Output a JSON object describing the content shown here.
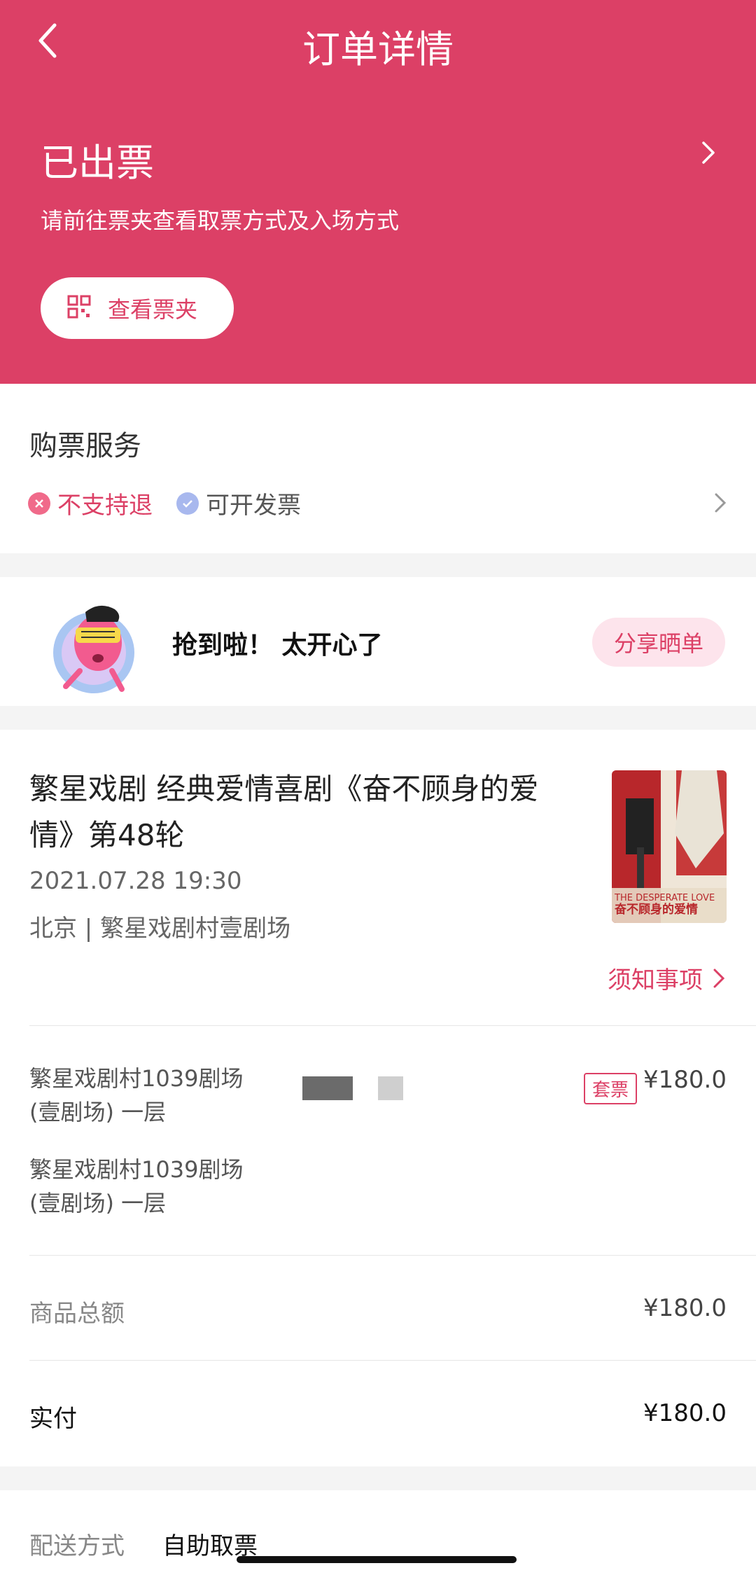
{
  "header": {
    "title": "订单详情",
    "status": "已出票",
    "hint": "请前往票夹查看取票方式及入场方式",
    "wallet_button": "查看票夹"
  },
  "service": {
    "title": "购票服务",
    "no_refund": "不支持退",
    "invoice": "可开发票"
  },
  "share": {
    "text": "抢到啦！ 太开心了",
    "button": "分享晒单"
  },
  "show": {
    "title": "繁星戏剧 经典爱情喜剧《奋不顾身的爱情》第48轮",
    "datetime": "2021.07.28 19:30",
    "venue": "北京 | 繁星戏剧村壹剧场",
    "notice": "须知事项",
    "poster_text_en": "THE DESPERATE LOVE",
    "poster_text_cn": "奋不顾身的爱情"
  },
  "tickets": {
    "seat1_line1": "繁星戏剧村1039剧场",
    "seat1_line2": "(壹剧场) 一层",
    "seat2_line1": "繁星戏剧村1039剧场",
    "seat2_line2": "(壹剧场) 一层",
    "tag": "套票",
    "price": "¥180.0"
  },
  "summary": {
    "goods_total_label": "商品总额",
    "goods_total_value": "¥180.0",
    "paid_label": "实付",
    "paid_value": "¥180.0"
  },
  "delivery": {
    "label": "配送方式",
    "value": "自助取票"
  },
  "colors": {
    "brand": "#dc4066",
    "brand_light": "#fde4ec"
  }
}
